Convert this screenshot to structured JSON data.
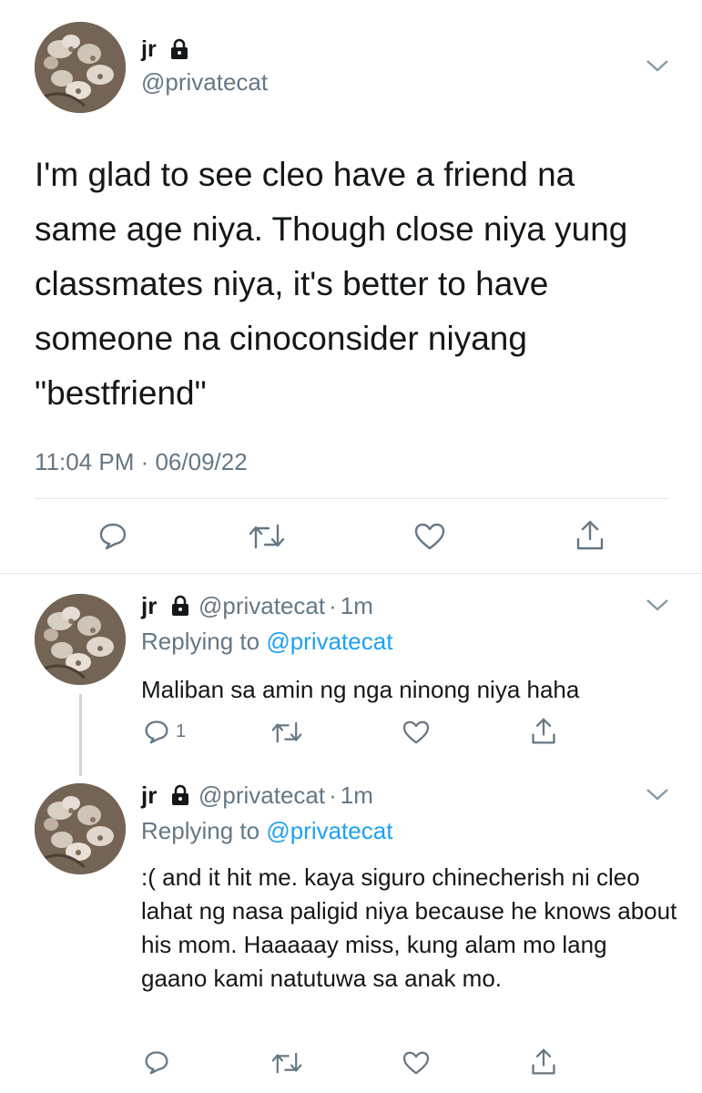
{
  "main_tweet": {
    "display_name": "jr",
    "handle": "@privatecat",
    "text": "I'm glad to see cleo have a friend na same age niya. Though close niya yung classmates niya, it's better to have someone na cinoconsider niyang \"bestfriend\"",
    "timestamp": "11:04 PM · 06/09/22"
  },
  "replies": [
    {
      "display_name": "jr",
      "handle": "@privatecat",
      "time": "1m",
      "replying_prefix": "Replying to",
      "replying_handle": "@privatecat",
      "text": "Maliban sa amin ng nga ninong niya haha",
      "reply_count": "1"
    },
    {
      "display_name": "jr",
      "handle": "@privatecat",
      "time": "1m",
      "replying_prefix": "Replying to",
      "replying_handle": "@privatecat",
      "text": ":( and it hit me. kaya siguro chinecherish ni cleo lahat ng nasa paligid niya because he knows about his mom. Haaaaay miss, kung alam mo lang gaano kami natutuwa sa anak mo."
    }
  ],
  "separator": "·",
  "icons": {
    "lock": "lock-icon",
    "chevron": "chevron-down-icon",
    "reply": "reply-icon",
    "retweet": "retweet-icon",
    "like": "heart-icon",
    "share": "share-icon"
  },
  "colors": {
    "text": "#14171a",
    "muted": "#657786",
    "link": "#1da1f2",
    "divider": "#e1e8ed"
  }
}
